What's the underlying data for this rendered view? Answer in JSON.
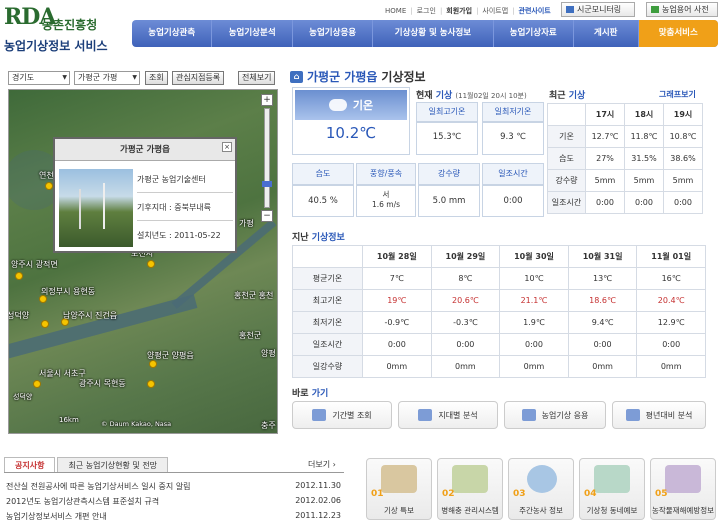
{
  "header": {
    "logo": "RDA",
    "org": "농촌진흥청",
    "service": "농업기상정보 서비스",
    "top_links": [
      "HOME",
      "로그인",
      "회원가입",
      "사이트맵",
      "관련사이트"
    ],
    "monitoring_btn": "시군모니터링",
    "second_btn": "농업용어 사전"
  },
  "nav": [
    "농업기상관측",
    "농업기상분석",
    "농업기상응용",
    "기상상황 및 농사정보",
    "농업기상자료",
    "게시판",
    "맞춤서비스"
  ],
  "map": {
    "province": "경기도",
    "county": "가평군 가평",
    "search_btn": "조회",
    "register_btn": "관심지점등록",
    "fullscreen_btn": "전체보기",
    "zoom_in": "+",
    "zoom_out": "−",
    "labels": [
      "연천",
      "양주시 광적면",
      "포천시",
      "의정부시 용현동",
      "남양주시 진건읍",
      "성덕양",
      "양평군 양평읍",
      "서울시 서초구",
      "광주시 목현동",
      "홍천군 홍천",
      "가평",
      "홍천군",
      "양평",
      "충주"
    ],
    "attribution": "© Daum Kakao, Nasa",
    "scale": "16km",
    "popup": {
      "title": "가평군 가평읍",
      "close": "×",
      "station": "가평군 농업기술센터",
      "climate_zone": "기후지대 : 중북부내륙",
      "installed": "설치년도 : 2011-05-22"
    }
  },
  "weather": {
    "title_loc": "가평군 가평읍",
    "title_suffix": " 기상정보",
    "current_label_a": "현재 ",
    "current_label_b": "기상",
    "current_time": "(11월02일 20시 10분)",
    "sky": "기온",
    "temp": "10.2℃",
    "max_label": "일최고기온",
    "max_val": "15.3℃",
    "min_label": "일최저기온",
    "min_val": "9.3 ℃",
    "humidity_label": "습도",
    "humidity_val": "40.5 %",
    "wind_label": "풍향/풍속",
    "wind_dir": "서",
    "wind_speed": "1.6 m/s",
    "rain_label": "강수량",
    "rain_val": "5.0 mm",
    "sun_label": "일조시간",
    "sun_val": "0:00"
  },
  "recent": {
    "label_a": "최근 ",
    "label_b": "기상",
    "graph_btn": "그래프보기",
    "hours": [
      "17시",
      "18시",
      "19시"
    ],
    "rows": [
      {
        "name": "기온",
        "vals": [
          "12.7℃",
          "11.8℃",
          "10.8℃"
        ]
      },
      {
        "name": "습도",
        "vals": [
          "27%",
          "31.5%",
          "38.6%"
        ]
      },
      {
        "name": "강수량",
        "vals": [
          "5mm",
          "5mm",
          "5mm"
        ]
      },
      {
        "name": "일조시간",
        "vals": [
          "0:00",
          "0:00",
          "0:00"
        ]
      }
    ]
  },
  "past": {
    "label_a": "지난 ",
    "label_b": "기상정보",
    "dates": [
      "10월 28일",
      "10월 29일",
      "10월 30일",
      "10월 31일",
      "11월 01일"
    ],
    "rows": [
      {
        "name": "평균기온",
        "vals": [
          "7℃",
          "8℃",
          "10℃",
          "13℃",
          "16℃"
        ]
      },
      {
        "name": "최고기온",
        "vals": [
          "19℃",
          "20.6℃",
          "21.1℃",
          "18.6℃",
          "20.4℃"
        ]
      },
      {
        "name": "최저기온",
        "vals": [
          "-0.9℃",
          "-0.3℃",
          "1.9℃",
          "9.4℃",
          "12.9℃"
        ]
      },
      {
        "name": "일조시간",
        "vals": [
          "0:00",
          "0:00",
          "0:00",
          "0:00",
          "0:00"
        ]
      },
      {
        "name": "일강수량",
        "vals": [
          "0mm",
          "0mm",
          "0mm",
          "0mm",
          "0mm"
        ]
      }
    ]
  },
  "shortcuts": {
    "label_a": "바로 ",
    "label_b": "가기",
    "items": [
      "기간별 조회",
      "지대별 분석",
      "농업기상 응용",
      "평년대비 분석"
    ]
  },
  "board": {
    "tab1": "공지사항",
    "tab2": "최근 농업기상현황 및 전망",
    "more": "더보기 ›",
    "notices": [
      {
        "title": "전산실 전원공사에 따른 농업기상서비스 일시 중지 알림",
        "date": "2012.11.30"
      },
      {
        "title": "2012년도 농업기상관측시스템 표준설치 규격",
        "date": "2012.02.06"
      },
      {
        "title": "농업기상정보서비스 개편 안내",
        "date": "2011.12.23"
      }
    ]
  },
  "services": [
    {
      "num": "01",
      "label": "기상 특보",
      "color": "#d9c7a0"
    },
    {
      "num": "02",
      "label": "병해충 관리시스템",
      "color": "#c8d6a8"
    },
    {
      "num": "03",
      "label": "주간농사 정보",
      "color": "#a8c6e4"
    },
    {
      "num": "04",
      "label": "기상청 동네예보",
      "color": "#b8d8c8"
    },
    {
      "num": "05",
      "label": "농작물재해예방정보",
      "color": "#c9b8d8"
    }
  ]
}
